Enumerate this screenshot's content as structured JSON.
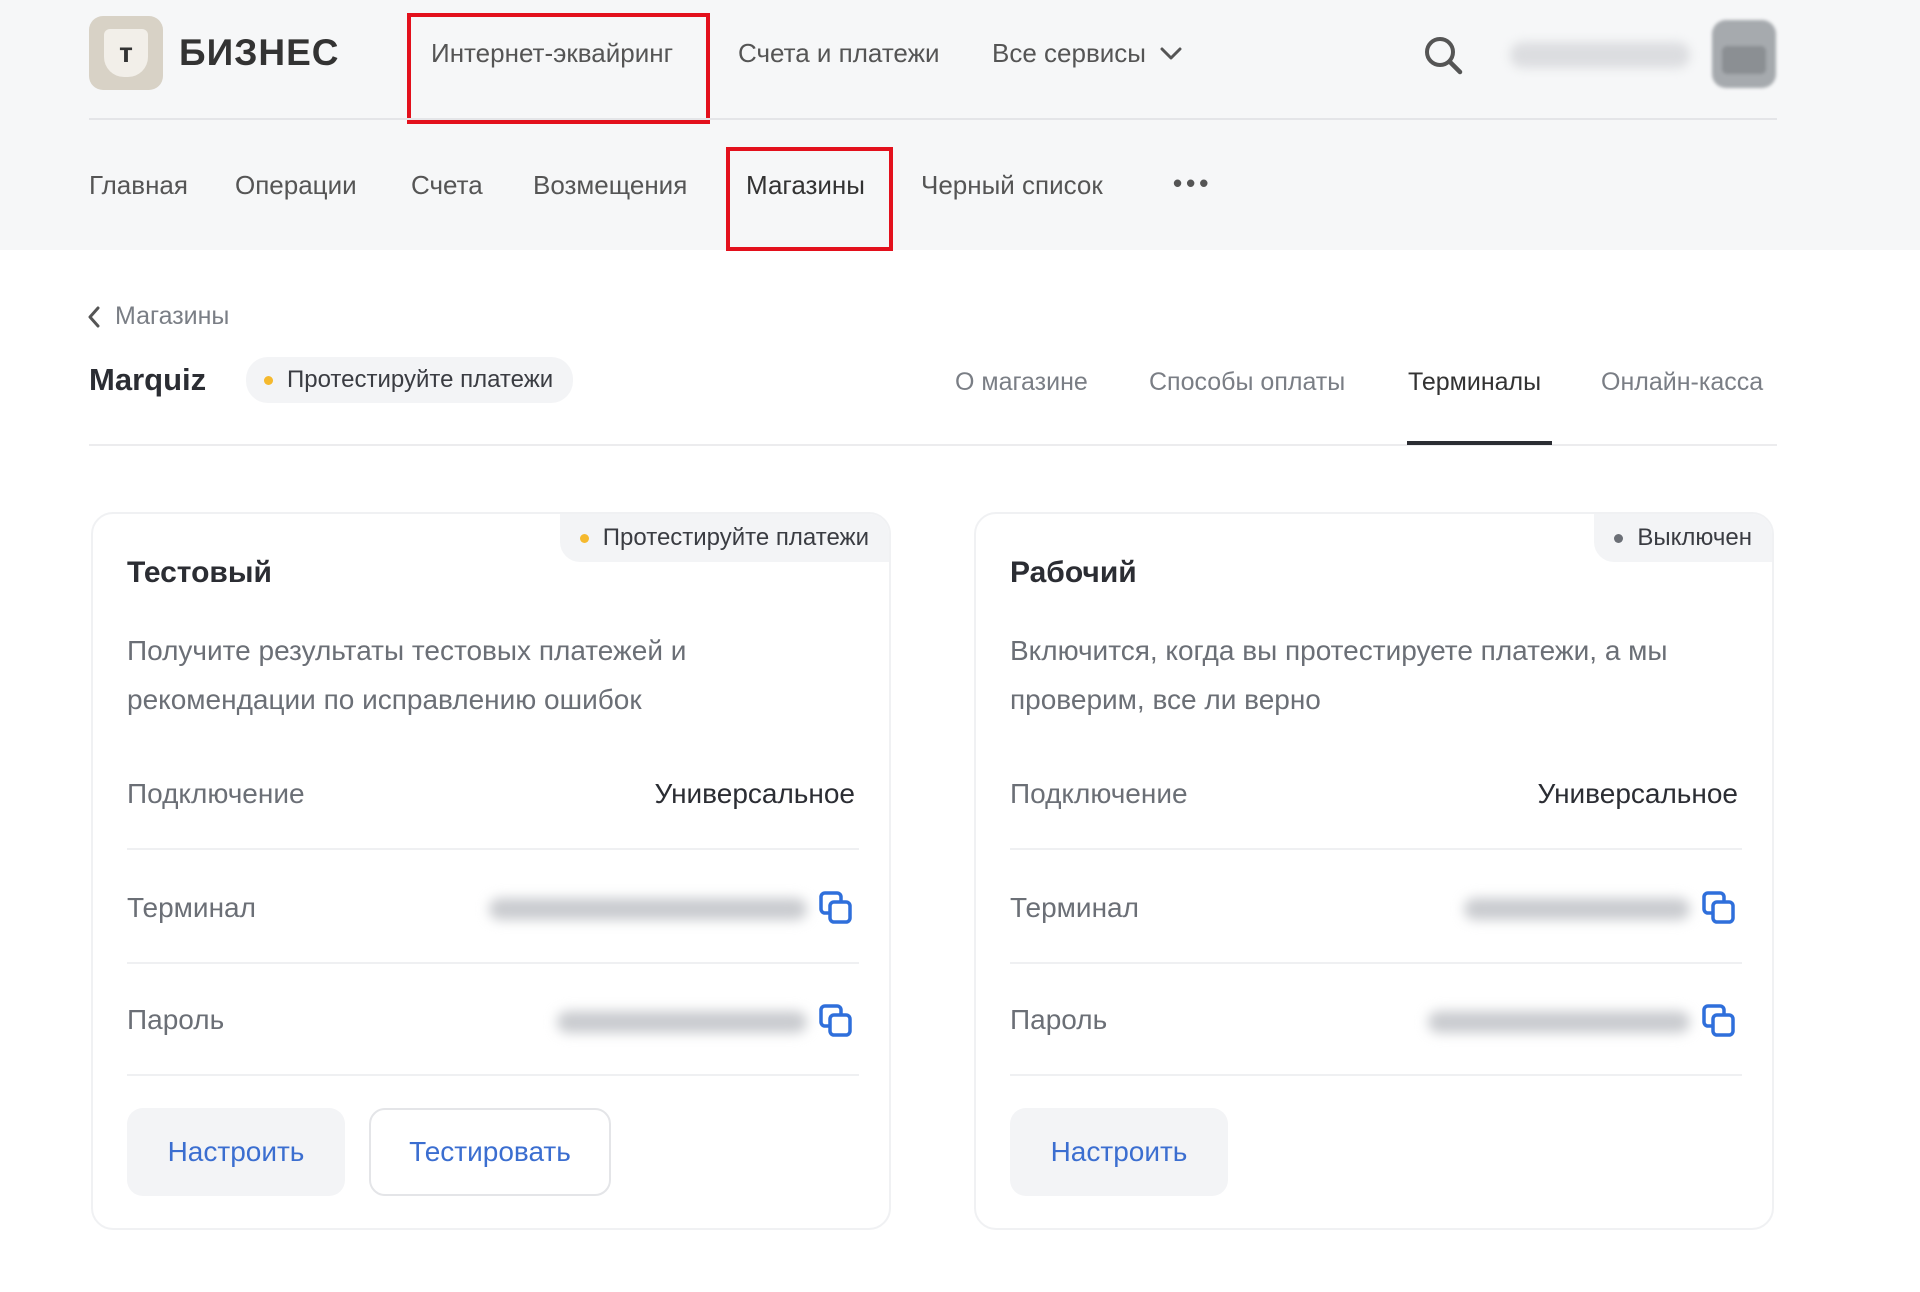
{
  "logo": {
    "mark": "т",
    "text": "БИЗНЕС"
  },
  "top_nav": [
    {
      "label": "Интернет-эквайринг",
      "highlighted": true
    },
    {
      "label": "Счета и платежи"
    },
    {
      "label": "Все сервисы"
    }
  ],
  "sub_nav": [
    {
      "label": "Главная"
    },
    {
      "label": "Операции"
    },
    {
      "label": "Счета"
    },
    {
      "label": "Возмещения"
    },
    {
      "label": "Магазины",
      "highlighted": true
    },
    {
      "label": "Черный список"
    }
  ],
  "more_label": "•••",
  "breadcrumb": {
    "label": "Магазины"
  },
  "store": {
    "name": "Marquiz",
    "status": "Протестируйте платежи",
    "status_color": "#f5b92e"
  },
  "tabs": [
    {
      "label": "О магазине"
    },
    {
      "label": "Способы оплаты"
    },
    {
      "label": "Терминалы",
      "active": true
    },
    {
      "label": "Онлайн-касса"
    }
  ],
  "cards": [
    {
      "title": "Тестовый",
      "status": "Протестируйте платежи",
      "status_color": "#f5b92e",
      "description": "Получите результаты тестовых платежей и рекомендации по исправлению ошибок",
      "rows": [
        {
          "label": "Подключение",
          "value": "Универсальное"
        },
        {
          "label": "Терминал"
        },
        {
          "label": "Пароль"
        }
      ],
      "buttons": [
        {
          "label": "Настроить"
        },
        {
          "label": "Тестировать"
        }
      ]
    },
    {
      "title": "Рабочий",
      "status": "Выключен",
      "status_color": "#6b6f76",
      "description": "Включится, когда вы протестируете платежи, а мы проверим, все ли верно",
      "rows": [
        {
          "label": "Подключение",
          "value": "Универсальное"
        },
        {
          "label": "Терминал"
        },
        {
          "label": "Пароль"
        }
      ],
      "buttons": [
        {
          "label": "Настроить"
        }
      ]
    }
  ],
  "colors": {
    "accent_link": "#3b6ed0",
    "highlight_box": "#e3101c",
    "icon_blue": "#2f6fdb"
  }
}
